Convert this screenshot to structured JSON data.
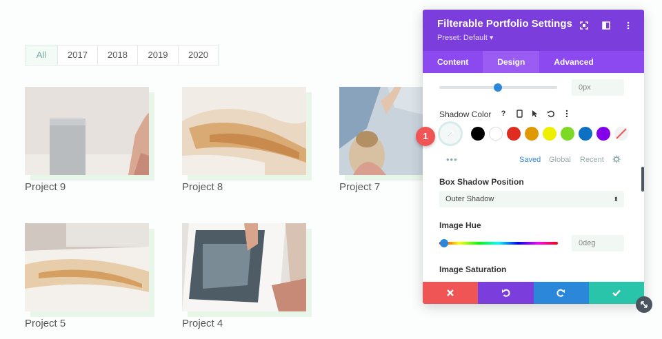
{
  "filters": [
    "All",
    "2017",
    "2018",
    "2019",
    "2020"
  ],
  "projects": [
    {
      "title": "Project 9"
    },
    {
      "title": "Project 8"
    },
    {
      "title": "Project 7"
    },
    {
      "title": "Project 5"
    },
    {
      "title": "Project 4"
    }
  ],
  "panel": {
    "title": "Filterable Portfolio Settings",
    "preset": "Preset: Default ▾",
    "tabs": [
      "Content",
      "Design",
      "Advanced"
    ],
    "active_tab": "Design",
    "top_slider_value": "0px",
    "shadow_color_label": "Shadow Color",
    "badge_number": "1",
    "swatch_colors": [
      "#000000",
      "#ffffff",
      "#e02b20",
      "#e09900",
      "#edf000",
      "#7cda24",
      "#0c71c3",
      "#8300e9"
    ],
    "saved_tabs": [
      "Saved",
      "Global",
      "Recent"
    ],
    "box_shadow_position_label": "Box Shadow Position",
    "box_shadow_position_value": "Outer Shadow",
    "image_hue_label": "Image Hue",
    "image_hue_value": "0deg",
    "image_saturation_label": "Image Saturation"
  },
  "colors": {
    "header": "#7b3ddb",
    "tabs": "#8b49ef",
    "cancel": "#ef5555",
    "undo": "#7b3ddb",
    "redo": "#2b87da",
    "save": "#29c4a9"
  }
}
